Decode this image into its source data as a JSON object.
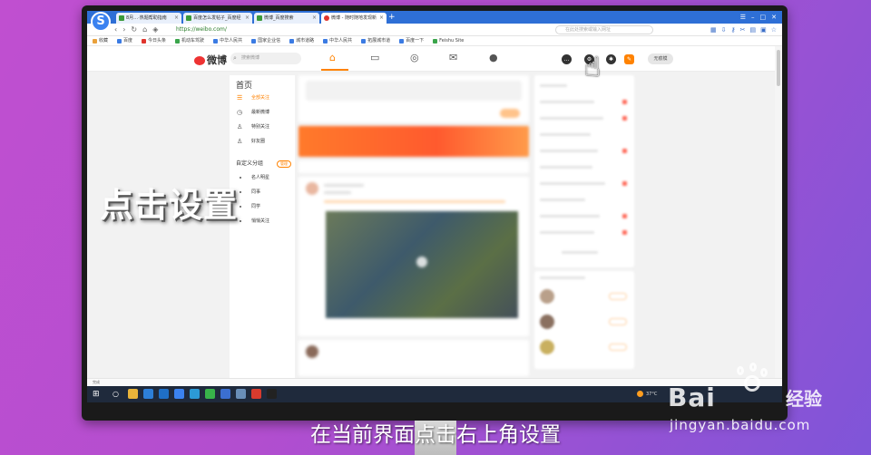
{
  "browser": {
    "tabs": [
      {
        "label": "8月…·热题帮助指南"
      },
      {
        "label": "百度怎么发帖子_百度经"
      },
      {
        "label": "微博_百度搜索"
      },
      {
        "label": "微博 - 随时随地发现新"
      }
    ],
    "url": "https://weibo.com/",
    "search_placeholder": "在此处搜索或输入网址",
    "bookmarks": [
      "收藏",
      "百度",
      "今日头条",
      "机动车驾驶",
      "中华人民共",
      "国家企业信",
      "城市道路",
      "中华人民共",
      "拓展城市道",
      "百度一下",
      "Feishu Site"
    ],
    "status_text": "完成"
  },
  "weibo": {
    "logo_text": "微博",
    "search_placeholder": "搜索微博",
    "login_label": "无痕模",
    "left_nav": {
      "title": "首页",
      "items": [
        "全部关注",
        "最新微博",
        "特别关注",
        "好友圈"
      ],
      "group_title": "自定义分组",
      "group_manage": "管理",
      "group_items": [
        "名人明星",
        "同事",
        "同学",
        "悄悄关注"
      ]
    }
  },
  "taskbar": {
    "weather": "37°C"
  },
  "overlay": {
    "left_text": "点击设置",
    "caption": "在当前界面点击右上角设置"
  },
  "watermark": {
    "brand": "Bai",
    "jingyan": "经验",
    "url": "jingyan.baidu.com"
  }
}
